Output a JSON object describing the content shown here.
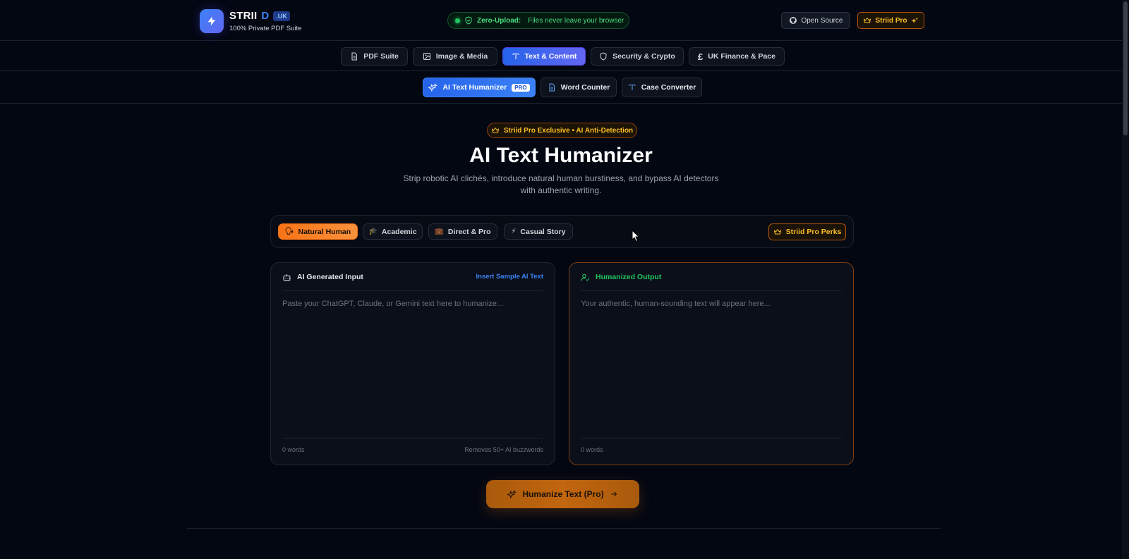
{
  "header": {
    "brand_name": "STRII",
    "brand_d": "D",
    "brand_tld": ".UK",
    "brand_sub": "100% Private PDF Suite",
    "zero_upload_label": "Zero-Upload:",
    "zero_upload_text": "Files never leave your browser",
    "open_source": "Open Source",
    "pro": "Striid Pro"
  },
  "categories": [
    {
      "label": "PDF Suite",
      "icon": "document-icon"
    },
    {
      "label": "Image & Media",
      "icon": "image-icon"
    },
    {
      "label": "Text & Content",
      "icon": "text-icon",
      "active": true
    },
    {
      "label": "Security & Crypto",
      "icon": "shield-icon"
    },
    {
      "label": "UK Finance & Pace",
      "icon": "pound-icon"
    }
  ],
  "subtools": [
    {
      "label": "AI Text Humanizer",
      "badge": "PRO",
      "icon": "sparkles-icon",
      "active": true
    },
    {
      "label": "Word Counter",
      "icon": "document-icon"
    },
    {
      "label": "Case Converter",
      "icon": "text-icon"
    }
  ],
  "hero": {
    "badge": "Striid Pro Exclusive • AI Anti-Detection",
    "title": "AI Text Humanizer",
    "subtitle": "Strip robotic AI clichés, introduce natural human burstiness, and bypass AI detectors with authentic writing."
  },
  "modes": [
    {
      "label": "Natural Human",
      "emoji": "🗣",
      "active": true
    },
    {
      "label": "Academic",
      "emoji": "🎓"
    },
    {
      "label": "Direct & Pro",
      "emoji": "💼"
    },
    {
      "label": "Casual Story",
      "emoji": "⚡"
    }
  ],
  "perks": "Striid Pro Perks",
  "input_panel": {
    "title": "AI Generated Input",
    "action": "Insert Sample AI Text",
    "placeholder": "Paste your ChatGPT, Claude, or Gemini text here to humanize...",
    "word_count": "0 words",
    "note": "Removes 50+ AI buzzwords"
  },
  "output_panel": {
    "title": "Humanized Output",
    "placeholder": "Your authentic, human-sounding text will appear here...",
    "word_count": "0 words"
  },
  "humanize_button": "Humanize Text (Pro)",
  "colors": {
    "background": "#030712",
    "accent_blue": "#3b82f6",
    "accent_orange": "#f97316",
    "pro_gold": "#fbbf24",
    "success_green": "#22c55e"
  }
}
